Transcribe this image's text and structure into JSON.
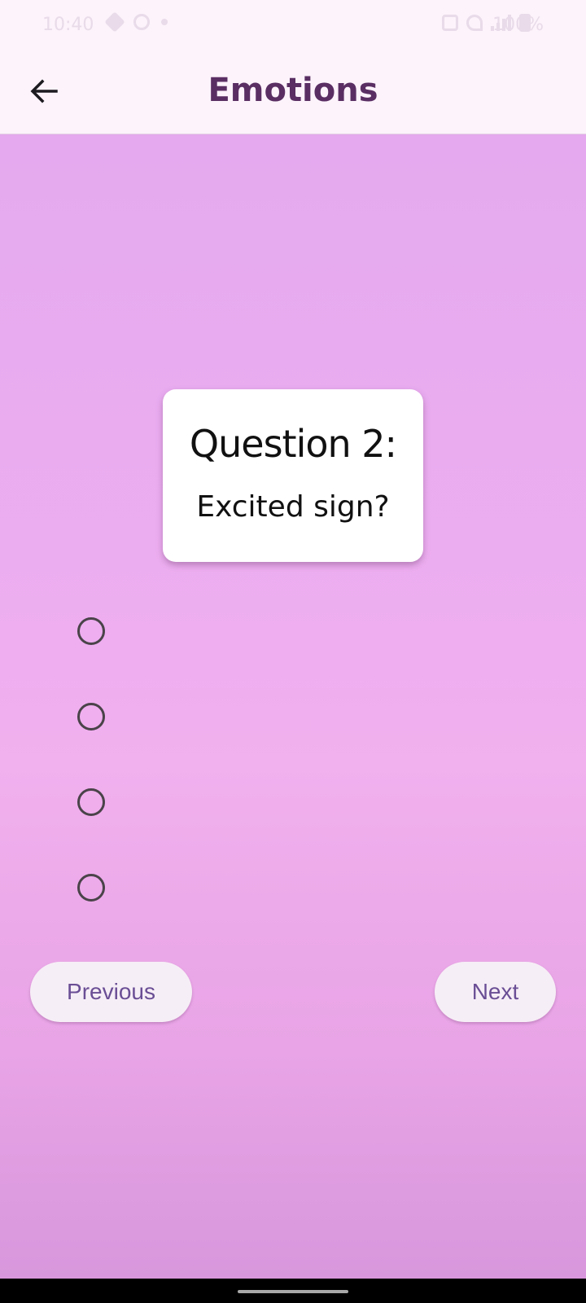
{
  "status_bar": {
    "time": "10:40",
    "battery": "100%"
  },
  "app_bar": {
    "title": "Emotions",
    "back_icon": "arrow-left-icon"
  },
  "question": {
    "number_label": "Question 2:",
    "text": "Excited sign?"
  },
  "options": [
    {
      "selected": false
    },
    {
      "selected": false
    },
    {
      "selected": false
    },
    {
      "selected": false
    }
  ],
  "navigation": {
    "previous_label": "Previous",
    "next_label": "Next"
  },
  "colors": {
    "app_bar_bg": "#fcf3fb",
    "title": "#5a2e63",
    "button_text": "#6a4e95",
    "button_bg": "#f6eef6",
    "content_top": "#e4a9ee",
    "content_mid": "#f1b0ee",
    "content_bottom": "#d897dc"
  }
}
